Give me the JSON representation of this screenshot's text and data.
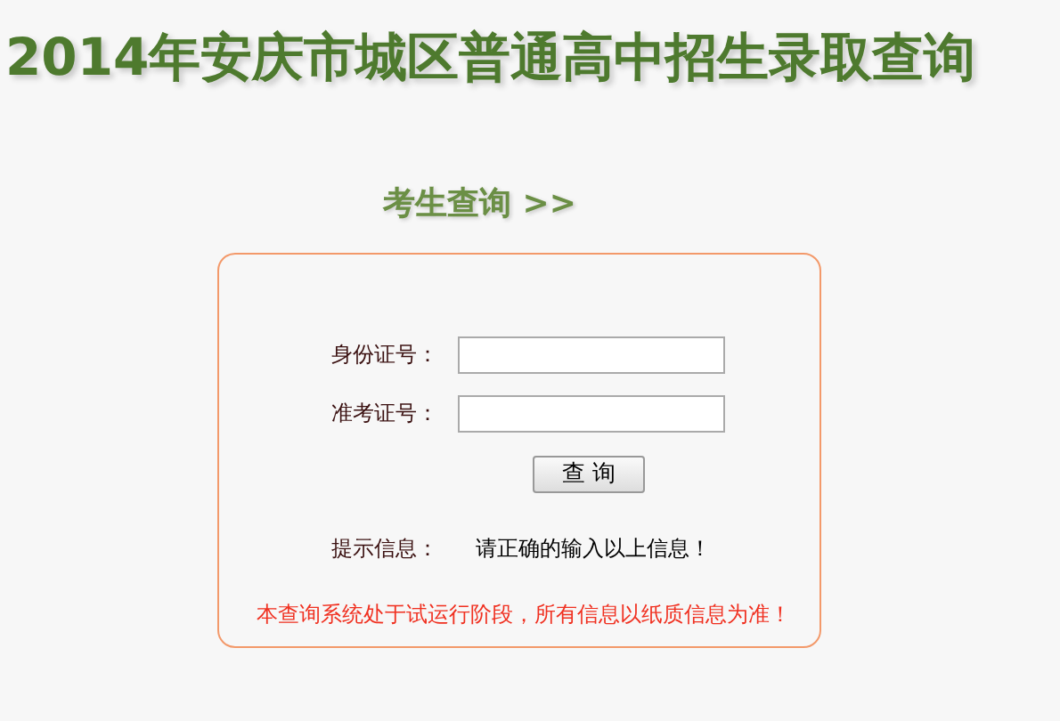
{
  "title": "2014年安庆市城区普通高中招生录取查询",
  "subtitle": "考生查询 >>",
  "form": {
    "fields": [
      {
        "label": "身份证号："
      },
      {
        "label": "准考证号："
      }
    ],
    "button": "查 询",
    "tip_label": "提示信息：",
    "tip_text": "请正确的输入以上信息！",
    "notice": "本查询系统处于试运行阶段，所有信息以纸质信息为准！"
  }
}
